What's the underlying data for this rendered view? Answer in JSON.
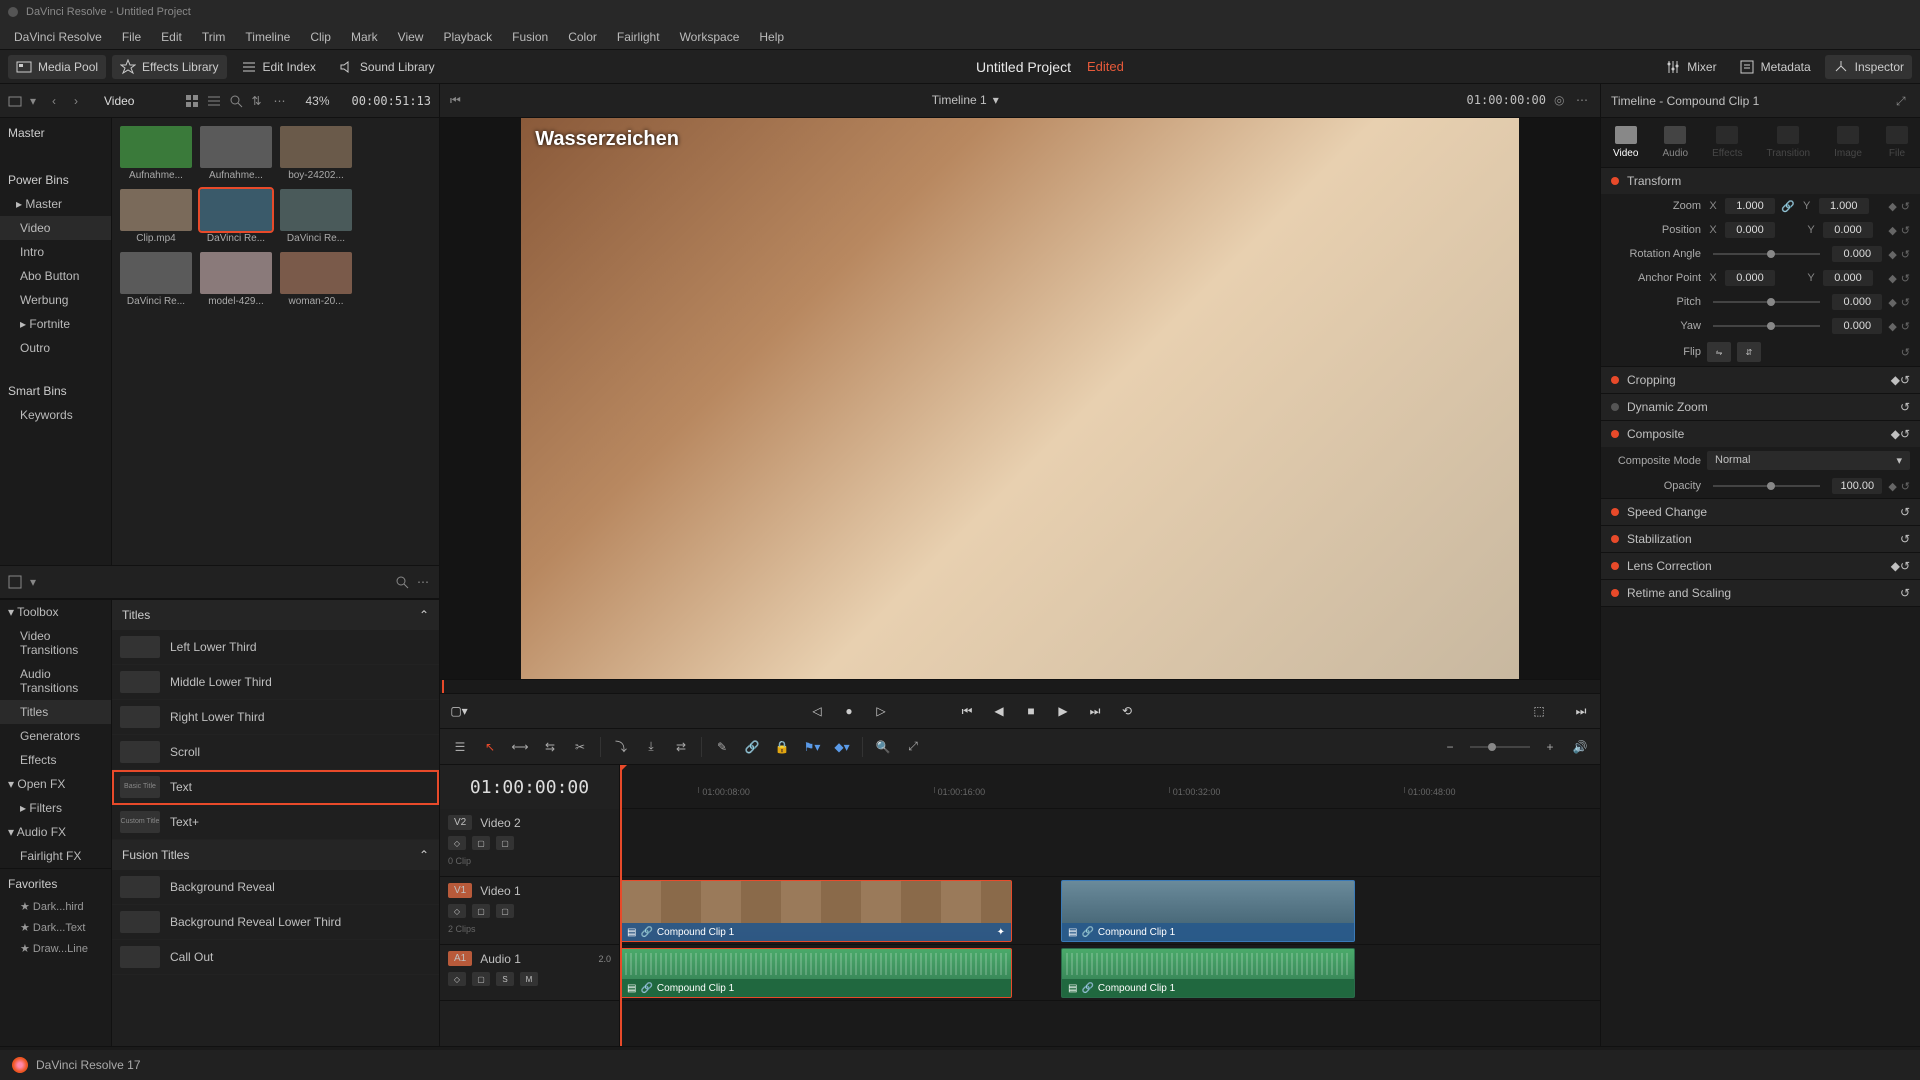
{
  "window_title": "DaVinci Resolve - Untitled Project",
  "menu": [
    "DaVinci Resolve",
    "File",
    "Edit",
    "Trim",
    "Timeline",
    "Clip",
    "Mark",
    "View",
    "Playback",
    "Fusion",
    "Color",
    "Fairlight",
    "Workspace",
    "Help"
  ],
  "toolbar": {
    "media_pool": "Media Pool",
    "effects_library": "Effects Library",
    "edit_index": "Edit Index",
    "sound_library": "Sound Library",
    "mixer": "Mixer",
    "metadata": "Metadata",
    "inspector": "Inspector"
  },
  "project_title": "Untitled Project",
  "edited_label": "Edited",
  "media_pool": {
    "current_bin": "Video",
    "zoom": "43%",
    "duration": "00:00:51:13",
    "tree": {
      "master": "Master",
      "power_bins": "Power Bins",
      "power_master": "Master",
      "bins": [
        "Video",
        "Intro",
        "Abo Button",
        "Werbung",
        "Fortnite",
        "Outro"
      ],
      "smart_bins": "Smart Bins",
      "keywords": "Keywords"
    },
    "clips": [
      {
        "name": "Aufnahme...",
        "color": "#3a7a3a"
      },
      {
        "name": "Aufnahme...",
        "color": "#5a5a5a"
      },
      {
        "name": "boy-24202...",
        "color": "#6a5a4a"
      },
      {
        "name": "Clip.mp4",
        "color": "#7a6a5a"
      },
      {
        "name": "DaVinci Re...",
        "color": "#3a5a6a",
        "selected": true
      },
      {
        "name": "DaVinci Re...",
        "color": "#4a5a5a"
      },
      {
        "name": "DaVinci Re...",
        "color": "#5a5a5a"
      },
      {
        "name": "model-429...",
        "color": "#8a7a7a"
      },
      {
        "name": "woman-20...",
        "color": "#7a5a4a"
      }
    ]
  },
  "effects": {
    "tree": {
      "toolbox": "Toolbox",
      "items": [
        "Video Transitions",
        "Audio Transitions",
        "Titles",
        "Generators",
        "Effects"
      ],
      "open_fx": "Open FX",
      "filters": "Filters",
      "audio_fx": "Audio FX",
      "fairlight_fx": "Fairlight FX"
    },
    "section_titles": "Titles",
    "titles": [
      {
        "name": "Left Lower Third"
      },
      {
        "name": "Middle Lower Third"
      },
      {
        "name": "Right Lower Third"
      },
      {
        "name": "Scroll"
      },
      {
        "name": "Text",
        "selected": true,
        "preview": "Basic Title"
      },
      {
        "name": "Text+",
        "preview": "Custom Title"
      }
    ],
    "section_fusion": "Fusion Titles",
    "fusion": [
      {
        "name": "Background Reveal"
      },
      {
        "name": "Background Reveal Lower Third"
      },
      {
        "name": "Call Out"
      }
    ],
    "favorites_label": "Favorites",
    "favorites": [
      "Dark...hird",
      "Dark...Text",
      "Draw...Line"
    ]
  },
  "viewer": {
    "timeline_name": "Timeline 1",
    "timecode": "01:00:00:00",
    "watermark": "Wasserzeichen"
  },
  "inspector": {
    "title": "Timeline - Compound Clip 1",
    "tabs": [
      "Video",
      "Audio",
      "Effects",
      "Transition",
      "Image",
      "File"
    ],
    "transform": {
      "label": "Transform",
      "zoom": {
        "label": "Zoom",
        "x": "1.000",
        "y": "1.000"
      },
      "position": {
        "label": "Position",
        "x": "0.000",
        "y": "0.000"
      },
      "rotation": {
        "label": "Rotation Angle",
        "val": "0.000"
      },
      "anchor": {
        "label": "Anchor Point",
        "x": "0.000",
        "y": "0.000"
      },
      "pitch": {
        "label": "Pitch",
        "val": "0.000"
      },
      "yaw": {
        "label": "Yaw",
        "val": "0.000"
      },
      "flip": {
        "label": "Flip"
      }
    },
    "cropping": "Cropping",
    "dynamic_zoom": "Dynamic Zoom",
    "composite": {
      "label": "Composite",
      "mode_label": "Composite Mode",
      "mode": "Normal",
      "opacity_label": "Opacity",
      "opacity": "100.00"
    },
    "speed": "Speed Change",
    "stabilization": "Stabilization",
    "lens": "Lens Correction",
    "retime": "Retime and Scaling"
  },
  "timeline": {
    "timecode": "01:00:00:00",
    "ticks": [
      "01:00:08:00",
      "01:00:16:00",
      "01:00:32:00",
      "01:00:48:00"
    ],
    "tracks": {
      "v2": {
        "badge": "V2",
        "name": "Video 2",
        "info": "0 Clip"
      },
      "v1": {
        "badge": "V1",
        "name": "Video 1",
        "info": "2 Clips"
      },
      "a1": {
        "badge": "A1",
        "name": "Audio 1",
        "meter": "2.0"
      }
    },
    "clip_name": "Compound Clip 1"
  },
  "footer": {
    "version": "DaVinci Resolve 17"
  }
}
